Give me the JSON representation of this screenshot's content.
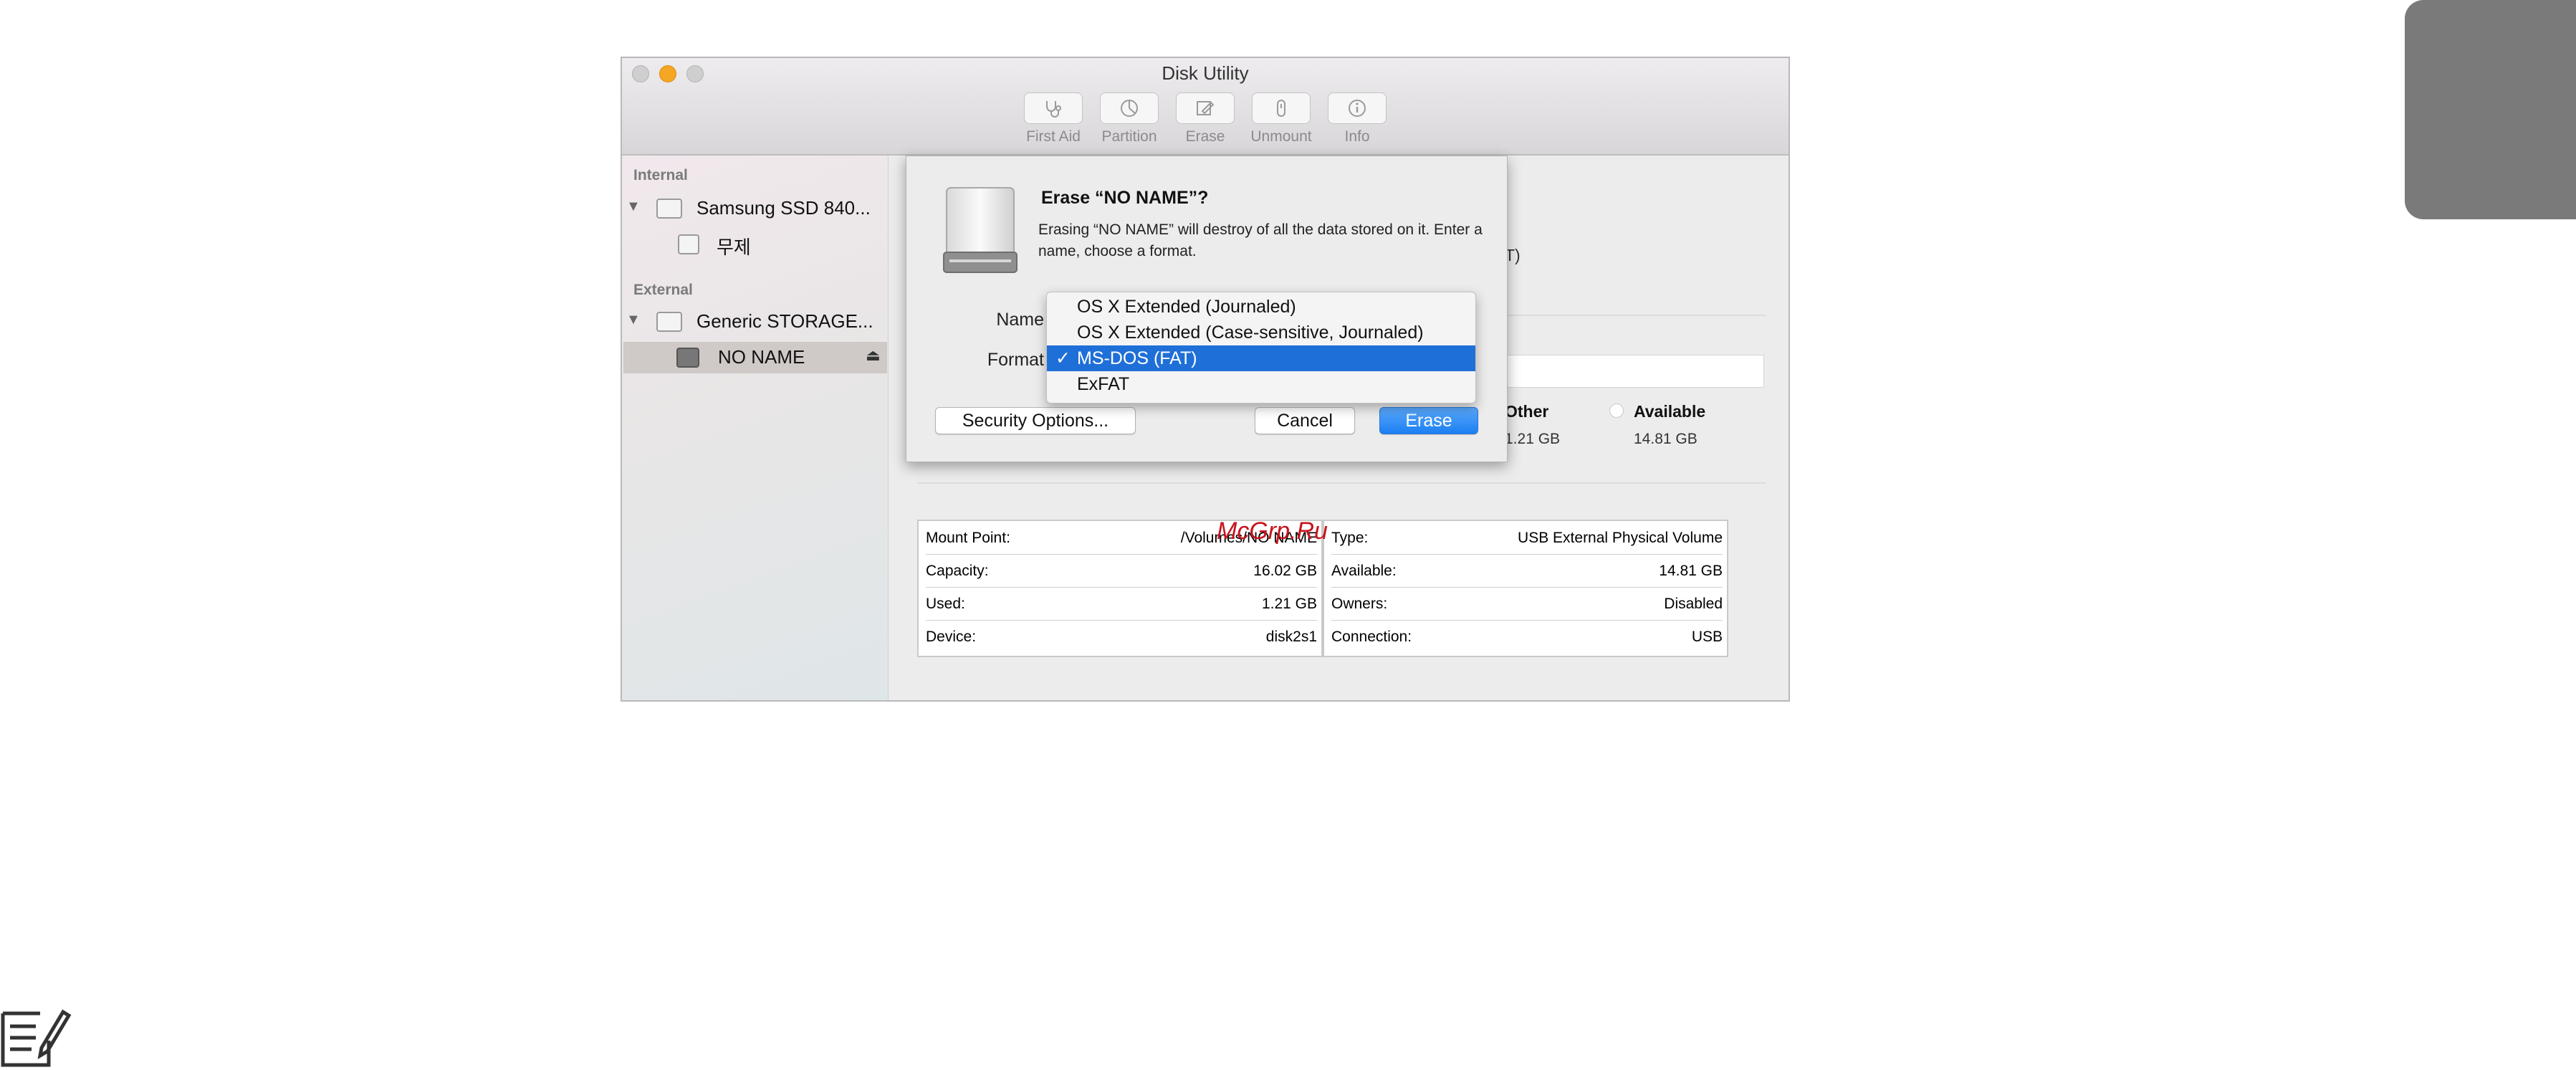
{
  "window": {
    "title": "Disk Utility",
    "toolbar": [
      {
        "label": "First Aid",
        "icon": "stethoscope-icon"
      },
      {
        "label": "Partition",
        "icon": "partition-icon"
      },
      {
        "label": "Erase",
        "icon": "erase-icon"
      },
      {
        "label": "Unmount",
        "icon": "unmount-icon"
      },
      {
        "label": "Info",
        "icon": "info-icon"
      }
    ]
  },
  "sidebar": {
    "internal_header": "Internal",
    "internal_disk": "Samsung SSD 840...",
    "internal_volume": "무제",
    "external_header": "External",
    "external_disk": "Generic STORAGE...",
    "external_volume": "NO NAME",
    "eject_glyph": "⏏"
  },
  "background": {
    "format_fragment": "T)",
    "other_label": "Other",
    "other_value": "1.21 GB",
    "available_label": "Available",
    "available_value": "14.81 GB"
  },
  "info_left": [
    {
      "key": "Mount Point:",
      "value": "/Volumes/NO NAME"
    },
    {
      "key": "Capacity:",
      "value": "16.02 GB"
    },
    {
      "key": "Used:",
      "value": "1.21 GB"
    },
    {
      "key": "Device:",
      "value": "disk2s1"
    }
  ],
  "info_right": [
    {
      "key": "Type:",
      "value": "USB External Physical Volume"
    },
    {
      "key": "Available:",
      "value": "14.81 GB"
    },
    {
      "key": "Owners:",
      "value": "Disabled"
    },
    {
      "key": "Connection:",
      "value": "USB"
    }
  ],
  "sheet": {
    "title": "Erase “NO NAME”?",
    "message": "Erasing “NO NAME” will destroy of all the data stored on it. Enter a name, choose a format.",
    "name_label": "Name",
    "format_label": "Format",
    "security_button": "Security Options...",
    "cancel_button": "Cancel",
    "erase_button": "Erase"
  },
  "format_menu": {
    "options": [
      "OS X Extended (Journaled)",
      "OS X Extended (Case-sensitive, Journaled)",
      "MS-DOS (FAT)",
      "ExFAT"
    ],
    "selected": "MS-DOS (FAT)",
    "check_glyph": "✓"
  },
  "watermark": "McGrp.Ru",
  "colors": {
    "accent": "#1f6fd8",
    "close": "#c8c8c8",
    "minimize": "#f5a623",
    "zoom": "#c8c8c8",
    "watermark": "#c8141d",
    "side_tab": "#7a7a7a"
  }
}
